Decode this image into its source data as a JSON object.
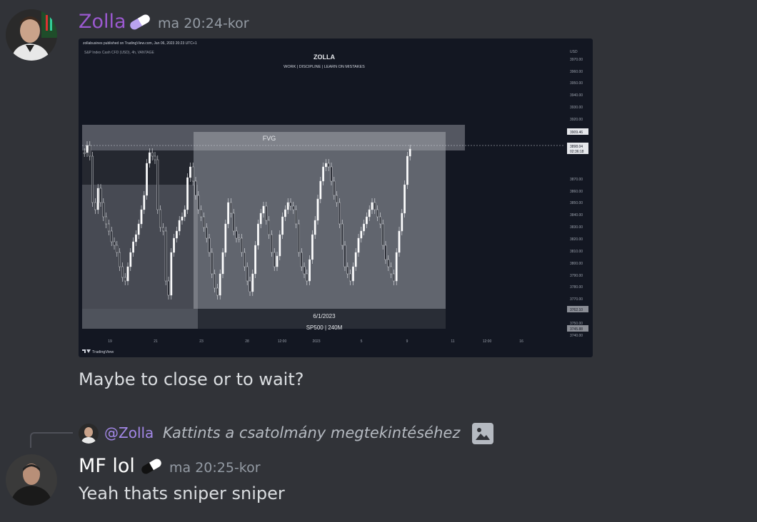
{
  "messages": [
    {
      "author": "Zolla",
      "author_color": "#9b59d0",
      "timestamp": "ma 20:24-kor",
      "badge_icon": "pill-icon",
      "text": "Maybe to close or to wait?",
      "attachment": {
        "header": "zollabusines published on TradingView.com, Jan 06, 2023 20:23 UTC+1",
        "symbol": "S&P Index Cash CFD (USD), 4h, VANTAGE",
        "title": "ZOLLA",
        "subtitle": "WORK  |  DISCIPLINE  |  LEARN ON MISTAKES",
        "fvg_label": "FVG",
        "date_label": "6/1/2023",
        "instrument_label": "SP500 | 240M",
        "currency": "USD",
        "price_ticks": [
          "3970.00",
          "3960.00",
          "3950.00",
          "3940.00",
          "3930.00",
          "3920.00",
          "3870.00",
          "3860.00",
          "3850.00",
          "3840.00",
          "3830.00",
          "3820.00",
          "3810.00",
          "3800.00",
          "3790.00",
          "3780.00",
          "3770.00",
          "3750.00",
          "3740.00"
        ],
        "price_marker_1": "3909.46",
        "price_marker_2": "3898.04",
        "price_marker_2_time": "02:36:18",
        "price_marker_3": "3762.10",
        "price_marker_4": "3745.88",
        "time_ticks": [
          "19",
          "21",
          "23",
          "28",
          "12:00",
          "2023",
          "5",
          "9",
          "11",
          "12:00",
          "16"
        ],
        "brand": "TradingView"
      }
    },
    {
      "reply_to": {
        "mention": "@Zolla",
        "text": "Kattints a csatolmány megtekintéséhez",
        "icon": "image-icon"
      },
      "author": "MF lol",
      "author_color": "#ffffff",
      "timestamp": "ma 20:25-kor",
      "badge_icon": "pill-icon",
      "text": "Yeah thats sniper sniper"
    }
  ]
}
